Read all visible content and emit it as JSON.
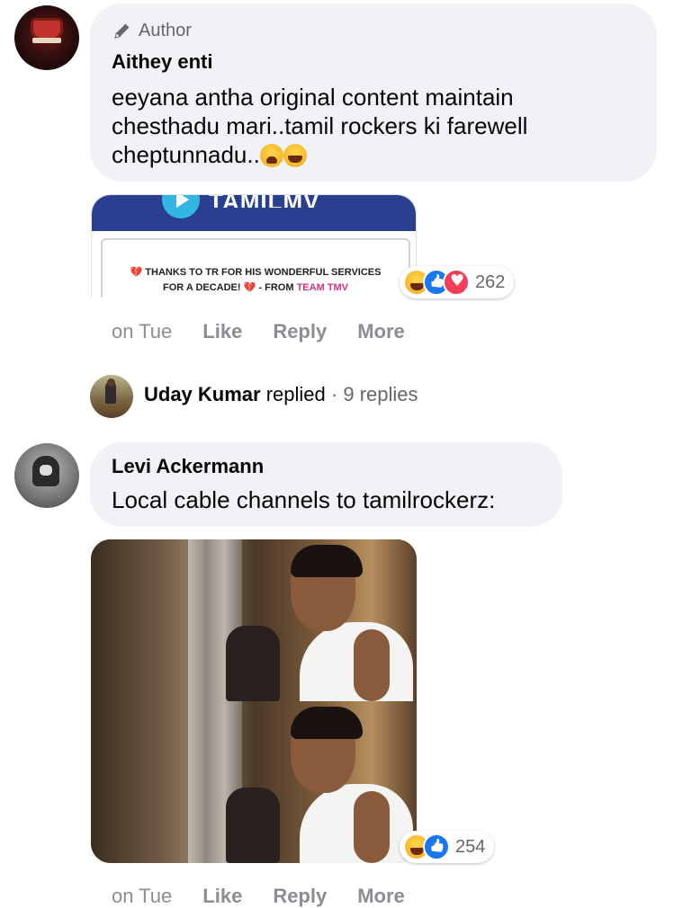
{
  "comment1": {
    "badge": "Author",
    "name": "Aithey enti",
    "text_line1": "eeyana antha original content maintain",
    "text_line2": "chesthadu mari..tamil rockers ki farewell",
    "text_line3": "cheptunnadu..",
    "emojis": [
      "crying-face",
      "laughing-face"
    ],
    "attachment": {
      "logo_text": "TAMILMV",
      "message_line1": "THANKS TO TR FOR HIS WONDERFUL SERVICES",
      "message_line2_a": "FOR A DECADE!",
      "message_line2_b": "- FROM",
      "message_line2_team": "TEAM TMV"
    },
    "reactions": {
      "icons": [
        "haha",
        "like",
        "love"
      ],
      "count": "262"
    },
    "actions": {
      "time": "on Tue",
      "like": "Like",
      "reply": "Reply",
      "more": "More"
    },
    "replies": {
      "name": "Uday Kumar",
      "verb": "replied",
      "separator": "·",
      "count": "9 replies"
    }
  },
  "comment2": {
    "name": "Levi Ackermann",
    "text": "Local cable channels to tamilrockerz:",
    "reactions": {
      "icons": [
        "haha",
        "like"
      ],
      "count": "254"
    },
    "actions": {
      "time": "on Tue",
      "like": "Like",
      "reply": "Reply",
      "more": "More"
    }
  },
  "colors": {
    "bubble": "#f0f2f5",
    "muted_text": "#8a8d91",
    "like_blue": "#1877f2",
    "love_red": "#f33e58",
    "tmv_band": "#2a3f8f",
    "tmv_logo": "#34b6e4"
  }
}
